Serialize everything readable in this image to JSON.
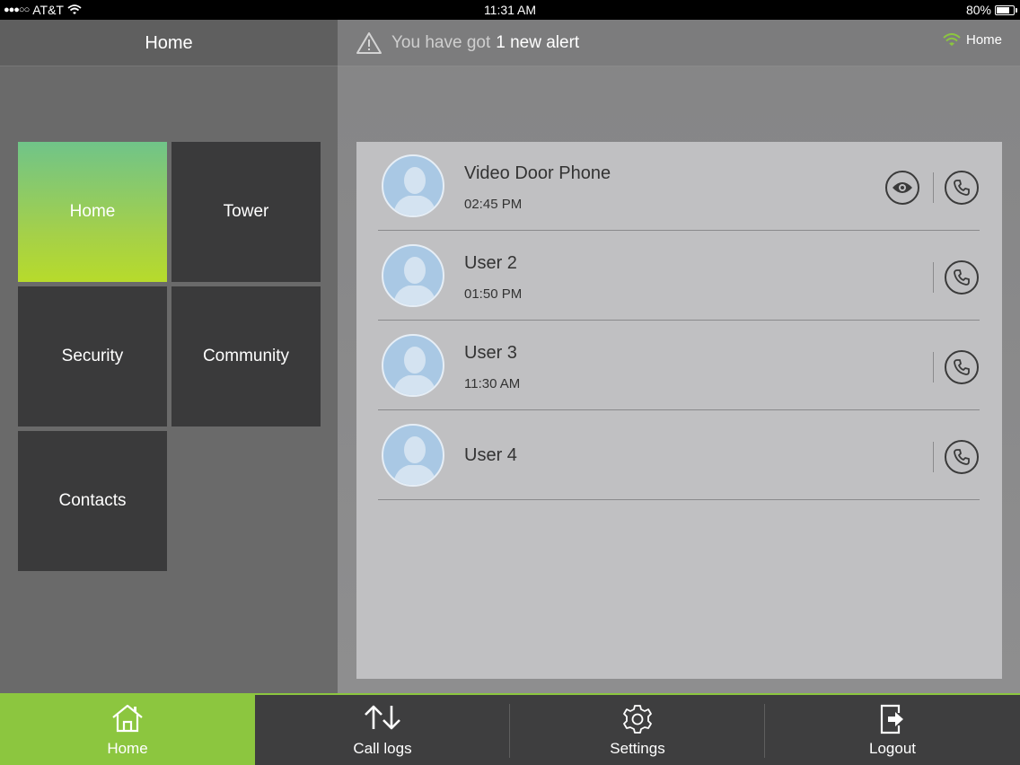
{
  "status_bar": {
    "carrier": "AT&T",
    "time": "11:31 AM",
    "battery": "80%",
    "battery_level": 0.8,
    "signal_icon": "signal-dots-icon",
    "wifi_icon": "wifi-icon"
  },
  "left_panel": {
    "title": "Home",
    "tiles": [
      {
        "label": "Home",
        "active": true
      },
      {
        "label": "Tower",
        "active": false
      },
      {
        "label": "Security",
        "active": false
      },
      {
        "label": "Community",
        "active": false
      },
      {
        "label": "Contacts",
        "active": false
      }
    ]
  },
  "header": {
    "alert_prefix": "You have got",
    "alert_highlight": "1 new alert",
    "alert_icon": "warning-icon",
    "connection_label": "Home",
    "connection_icon": "wifi-icon",
    "connection_color": "#8cc63f"
  },
  "contacts": [
    {
      "name": "Video Door Phone",
      "time": "02:45 PM",
      "has_view": true
    },
    {
      "name": "User 2",
      "time": "01:50 PM",
      "has_view": false
    },
    {
      "name": "User 3",
      "time": "11:30 AM",
      "has_view": false
    },
    {
      "name": "User 4",
      "time": "",
      "has_view": false
    }
  ],
  "bottom_nav": [
    {
      "label": "Home",
      "icon": "home-icon",
      "active": true
    },
    {
      "label": "Call logs",
      "icon": "call-logs-icon",
      "active": false
    },
    {
      "label": "Settings",
      "icon": "gear-icon",
      "active": false
    },
    {
      "label": "Logout",
      "icon": "logout-icon",
      "active": false
    }
  ],
  "colors": {
    "accent": "#8cc63f",
    "tile_dark": "#3a3a3b",
    "list_bg": "#c0c0c2"
  }
}
